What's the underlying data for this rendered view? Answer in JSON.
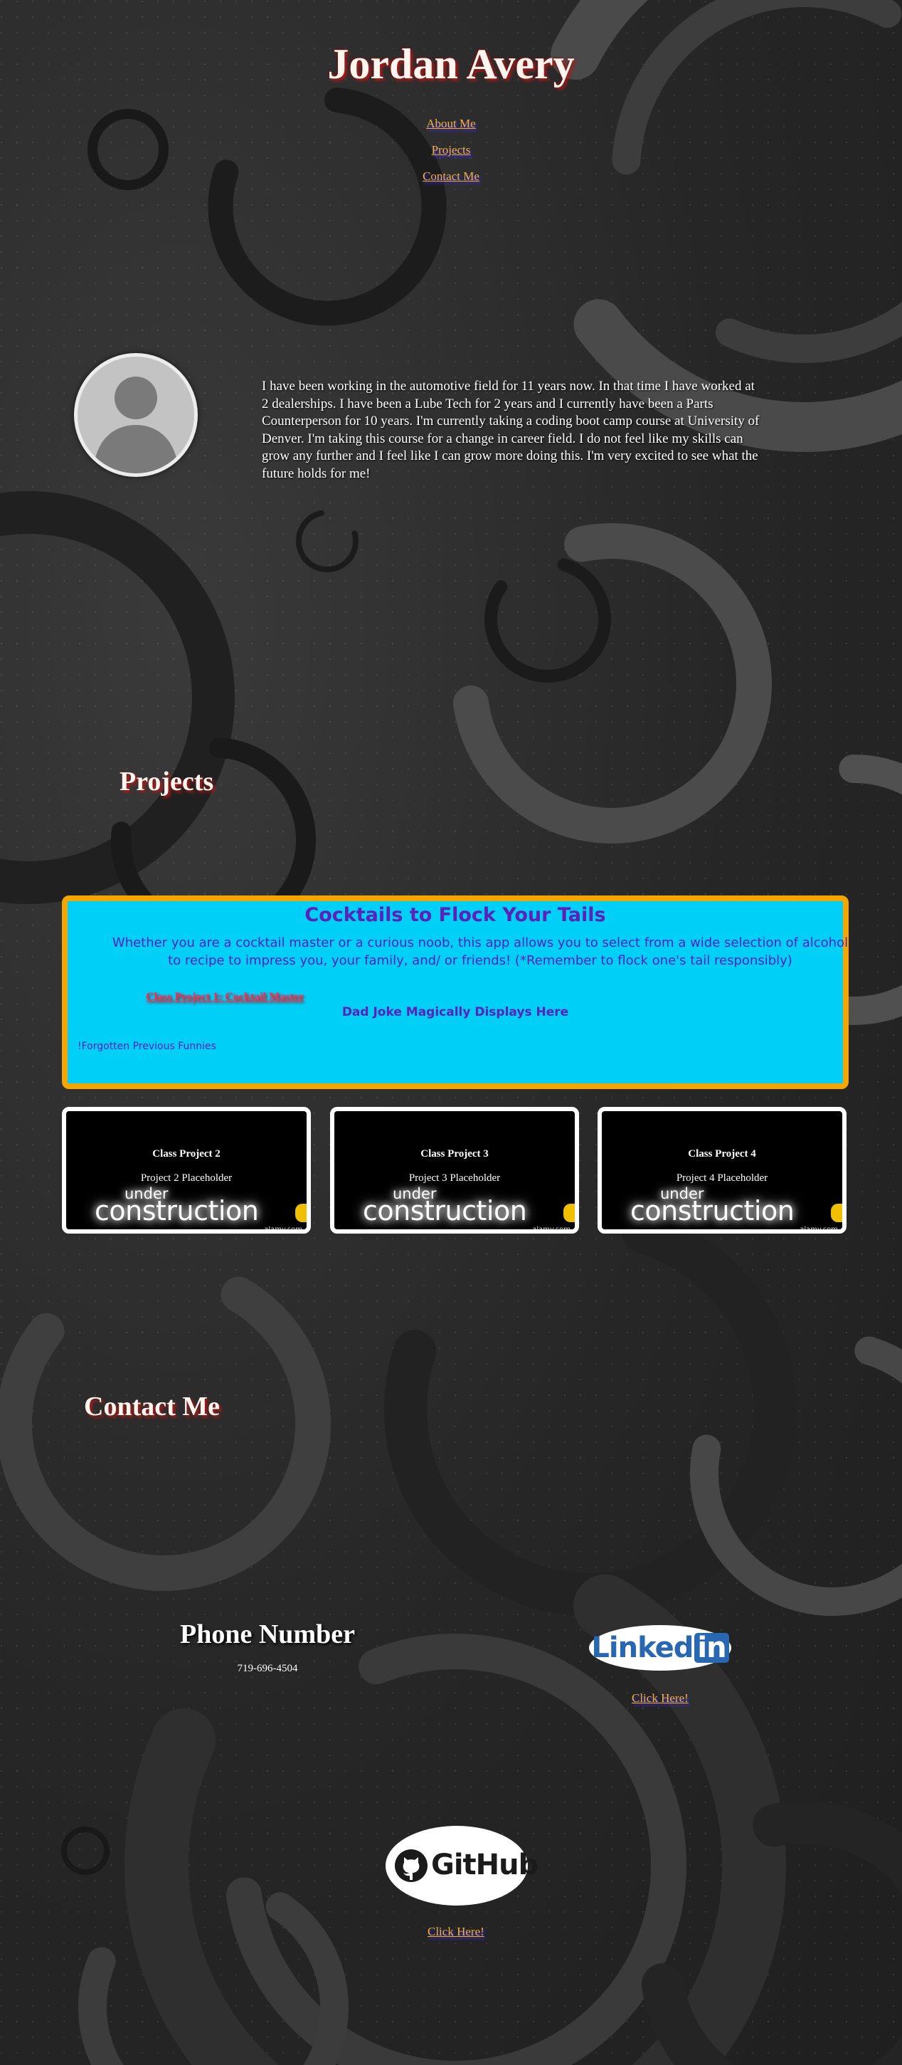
{
  "header": {
    "title": "Jordan Avery",
    "nav": [
      "About Me",
      "Projects",
      "Contact Me"
    ]
  },
  "about": {
    "text": "I have been working in the automotive field for 11 years now. In that time I have worked at 2 dealerships. I have been a Lube Tech for 2 years and I currently have been a Parts Counterperson for 10 years. I'm currently taking a coding boot camp course at University of Denver. I'm taking this course for a change in career field. I do not feel like my skills can grow any further and I feel like I can grow more doing this. I'm very excited to see what the future holds for me!"
  },
  "projects": {
    "heading": "Projects",
    "featured": {
      "title": "Cocktails to Flock Your Tails",
      "description": "Whether you are a cocktail master or a curious noob, this app allows you to select from a wide selection of alcohol to recipe to impress you, your family, and/ or friends! (*Remember to flock one's tail responsibly)",
      "link_label": "Class Project 1: Cocktail Master",
      "joke_label": "Dad Joke Magically Displays Here",
      "forgotten_label": "!Forgotten Previous Funnies"
    },
    "cards": [
      {
        "title": "Class Project 2",
        "placeholder": "Project 2 Placeholder"
      },
      {
        "title": "Class Project 3",
        "placeholder": "Project 3 Placeholder"
      },
      {
        "title": "Class Project 4",
        "placeholder": "Project 4 Placeholder"
      }
    ],
    "under_construction": {
      "line1": "under",
      "line2": "construction",
      "watermark": "alamy.com"
    }
  },
  "contact": {
    "heading": "Contact Me",
    "phone_heading": "Phone Number",
    "phone_number": "719-696-4504",
    "linkedin": {
      "logo_word": "Linked",
      "logo_box": "in",
      "link_label": "Click Here!"
    },
    "github": {
      "logo_word": "GitHub",
      "link_label": "Click Here!"
    }
  },
  "colors": {
    "link": "#f5b32e",
    "heading_shadow": "#b01818",
    "featured_bg": "#00cff8",
    "featured_border": "#f6a400",
    "featured_text": "#5b21b8"
  }
}
